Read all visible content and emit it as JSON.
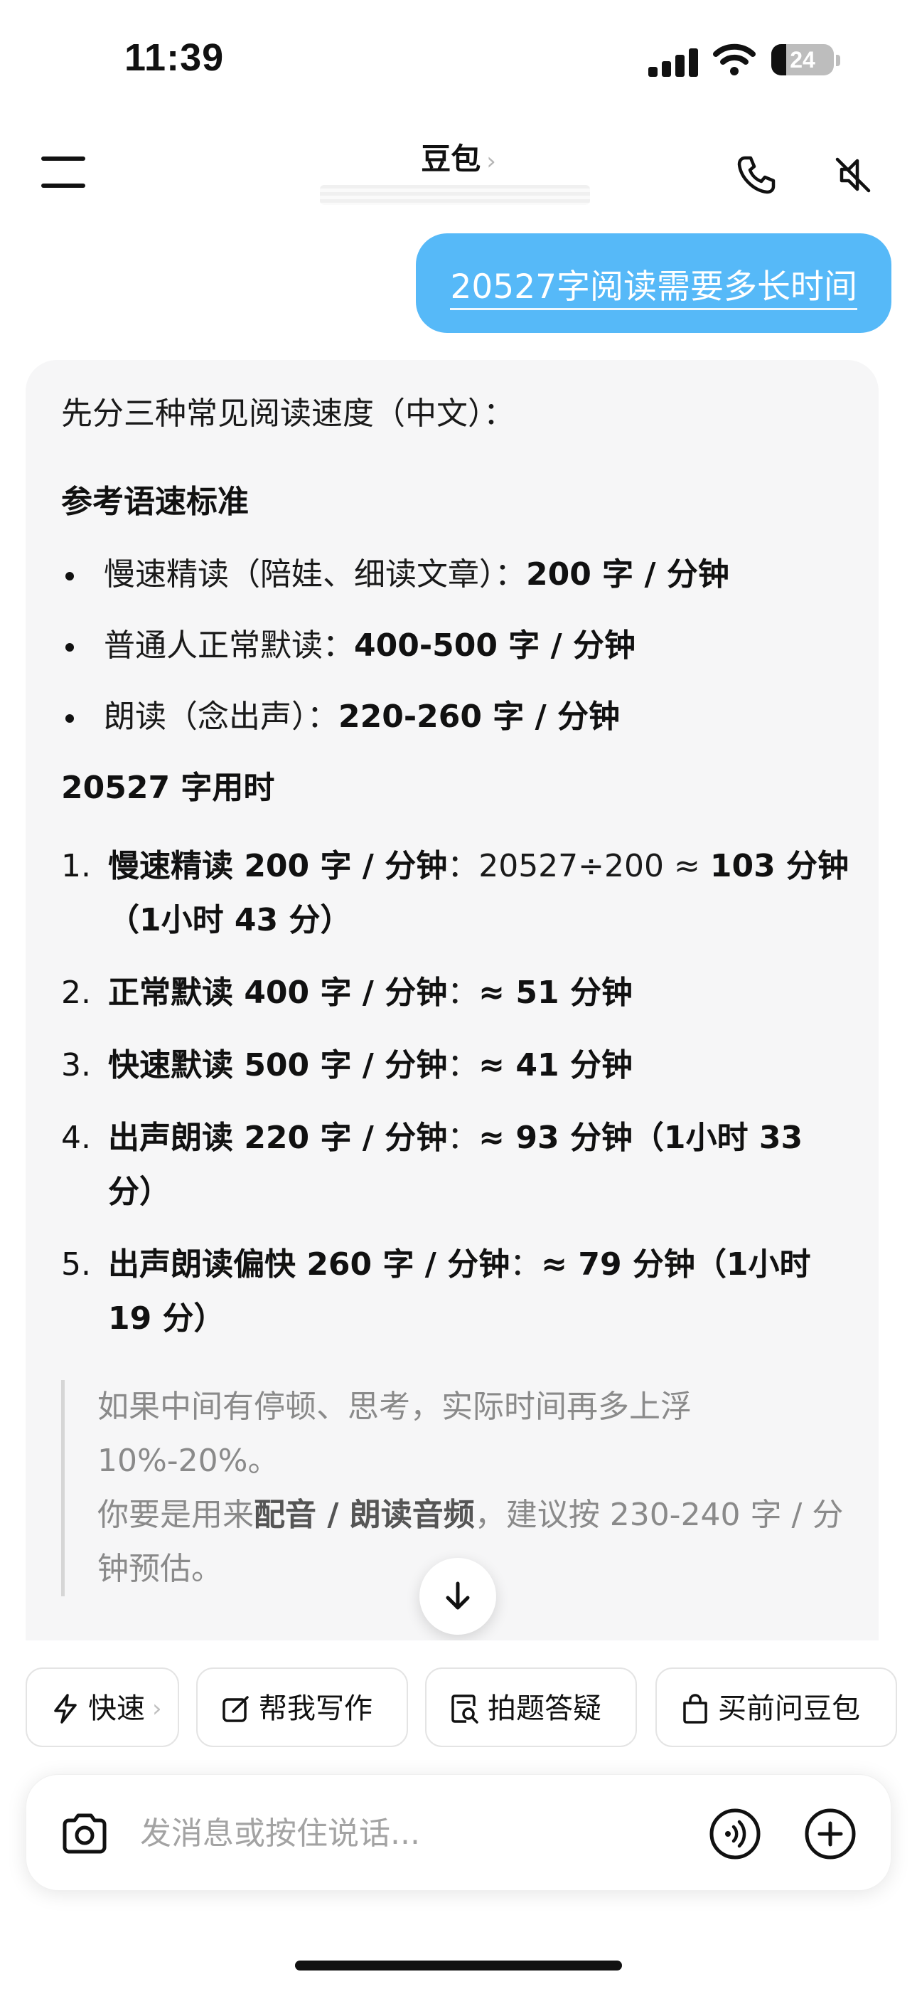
{
  "status_bar": {
    "time": "11:39",
    "battery_level": "24",
    "battery_fraction": 0.24,
    "icons": [
      "signal-icon",
      "wifi-icon",
      "battery-icon"
    ]
  },
  "header": {
    "title": "豆包",
    "title_chevron": "›",
    "icons": [
      "menu-icon",
      "phone-icon",
      "speaker-muted-icon"
    ]
  },
  "user_message": "20527字阅读需要多长时间",
  "reply": {
    "intro": "先分三种常见阅读速度（中文）：",
    "section1_title": "参考语速标准",
    "bullets": [
      {
        "label": "慢速精读（陪娃、细读文章）：",
        "value": "200 字 / 分钟"
      },
      {
        "label": "普通人正常默读：",
        "value": "400-500 字 / 分钟"
      },
      {
        "label": "朗读（念出声）：",
        "value": "220-260 字 / 分钟"
      }
    ],
    "section2_title": "20527 字用时",
    "items": [
      {
        "num": "1.",
        "label": "慢速精读 200 字 / 分钟",
        "sep": "：",
        "calc": "20527÷200 ≈ ",
        "result": "103 分钟（1小时 43 分）"
      },
      {
        "num": "2.",
        "label": "正常默读 400 字 / 分钟",
        "sep": "：",
        "calc": "",
        "result": "≈ 51 分钟"
      },
      {
        "num": "3.",
        "label": "快速默读 500 字 / 分钟",
        "sep": "：",
        "calc": "",
        "result": "≈ 41 分钟"
      },
      {
        "num": "4.",
        "label": "出声朗读 220 字 / 分钟",
        "sep": "：",
        "calc": "",
        "result": "≈ 93 分钟（1小时 33 分）"
      },
      {
        "num": "5.",
        "label": "出声朗读偏快 260 字 / 分钟",
        "sep": "：",
        "calc": "",
        "result": "≈ 79 分钟（1小时 19 分）"
      }
    ],
    "note_line1": "如果中间有停顿、思考，实际时间再多上浮 10%-20%。",
    "note_line2_pre": "你要是用来",
    "note_line2_bold": "配音 / 朗读音频",
    "note_line2_post": "，建议按 230-240 字 / 分钟预估。"
  },
  "chips": [
    {
      "label": "快速",
      "chevron": "›",
      "icon": "lightning-icon"
    },
    {
      "label": "帮我写作",
      "icon": "edit-icon"
    },
    {
      "label": "拍题答疑",
      "icon": "search-doc-icon"
    },
    {
      "label": "买前问豆包",
      "icon": "shopping-bag-icon"
    }
  ],
  "input": {
    "placeholder": "发消息或按住说话...",
    "icons": [
      "camera-icon",
      "voice-call-icon",
      "plus-icon"
    ]
  },
  "colors": {
    "user_bubble": "#56b9f8",
    "reply_bg": "#f6f6f7",
    "text": "#111111",
    "muted_text": "#8a8a8a"
  }
}
